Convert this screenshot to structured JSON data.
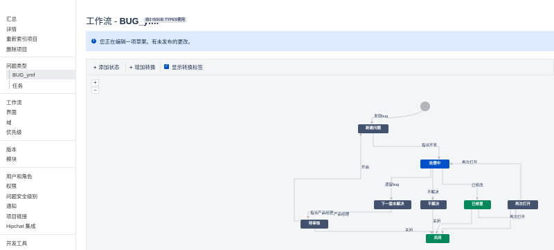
{
  "sidebar": {
    "items": [
      {
        "label": "汇总"
      },
      {
        "label": "详情"
      },
      {
        "label": "重新索引项目"
      },
      {
        "label": "删除项目"
      },
      {
        "label": "问题类型"
      },
      {
        "label": "BUG_ymf"
      },
      {
        "label": "任务"
      },
      {
        "label": "工作流"
      },
      {
        "label": "界面"
      },
      {
        "label": "域"
      },
      {
        "label": "优先级"
      },
      {
        "label": "版本"
      },
      {
        "label": "模块"
      },
      {
        "label": "用户和角色"
      },
      {
        "label": "权限"
      },
      {
        "label": "问题安全级别"
      },
      {
        "label": "通知"
      },
      {
        "label": "项目链接"
      },
      {
        "label": "Hipchat 集成"
      },
      {
        "label": "开发工具"
      }
    ]
  },
  "header": {
    "title_prefix": "工作流 - ",
    "title_name": "BUG_ymf",
    "badge": "由2 ISSUE TYPES使用"
  },
  "banner": {
    "text": "您正在编辑一项草案。有未发布的更改。"
  },
  "toolbar": {
    "add_status": "添加状态",
    "add_transition": "增加转换",
    "show_labels": "显示转换标签",
    "show_labels_checked": true
  },
  "zoom": {
    "in": "+",
    "out": "−"
  },
  "diagram": {
    "nodes": [
      {
        "label": "新建问题",
        "color": "#42526e"
      },
      {
        "label": "处理中",
        "color": "#0052cc"
      },
      {
        "label": "下一版本解决",
        "color": "#42526e"
      },
      {
        "label": "不解决",
        "color": "#42526e"
      },
      {
        "label": "已修复",
        "color": "#00875a"
      },
      {
        "label": "再次打开",
        "color": "#42526e"
      },
      {
        "label": "待审核",
        "color": "#42526e"
      },
      {
        "label": "关闭",
        "color": "#00875a"
      }
    ],
    "transitions": [
      {
        "label": "发现bug"
      },
      {
        "label": "指派开发"
      },
      {
        "label": "开启"
      },
      {
        "label": "再次打开"
      },
      {
        "label": "遗留bug"
      },
      {
        "label": "不解决"
      },
      {
        "label": "已修改"
      },
      {
        "label": "指派产品经理"
      },
      {
        "label": "产品经理"
      },
      {
        "label": "关闭"
      },
      {
        "label": "关闭"
      },
      {
        "label": "再次打开"
      }
    ]
  }
}
